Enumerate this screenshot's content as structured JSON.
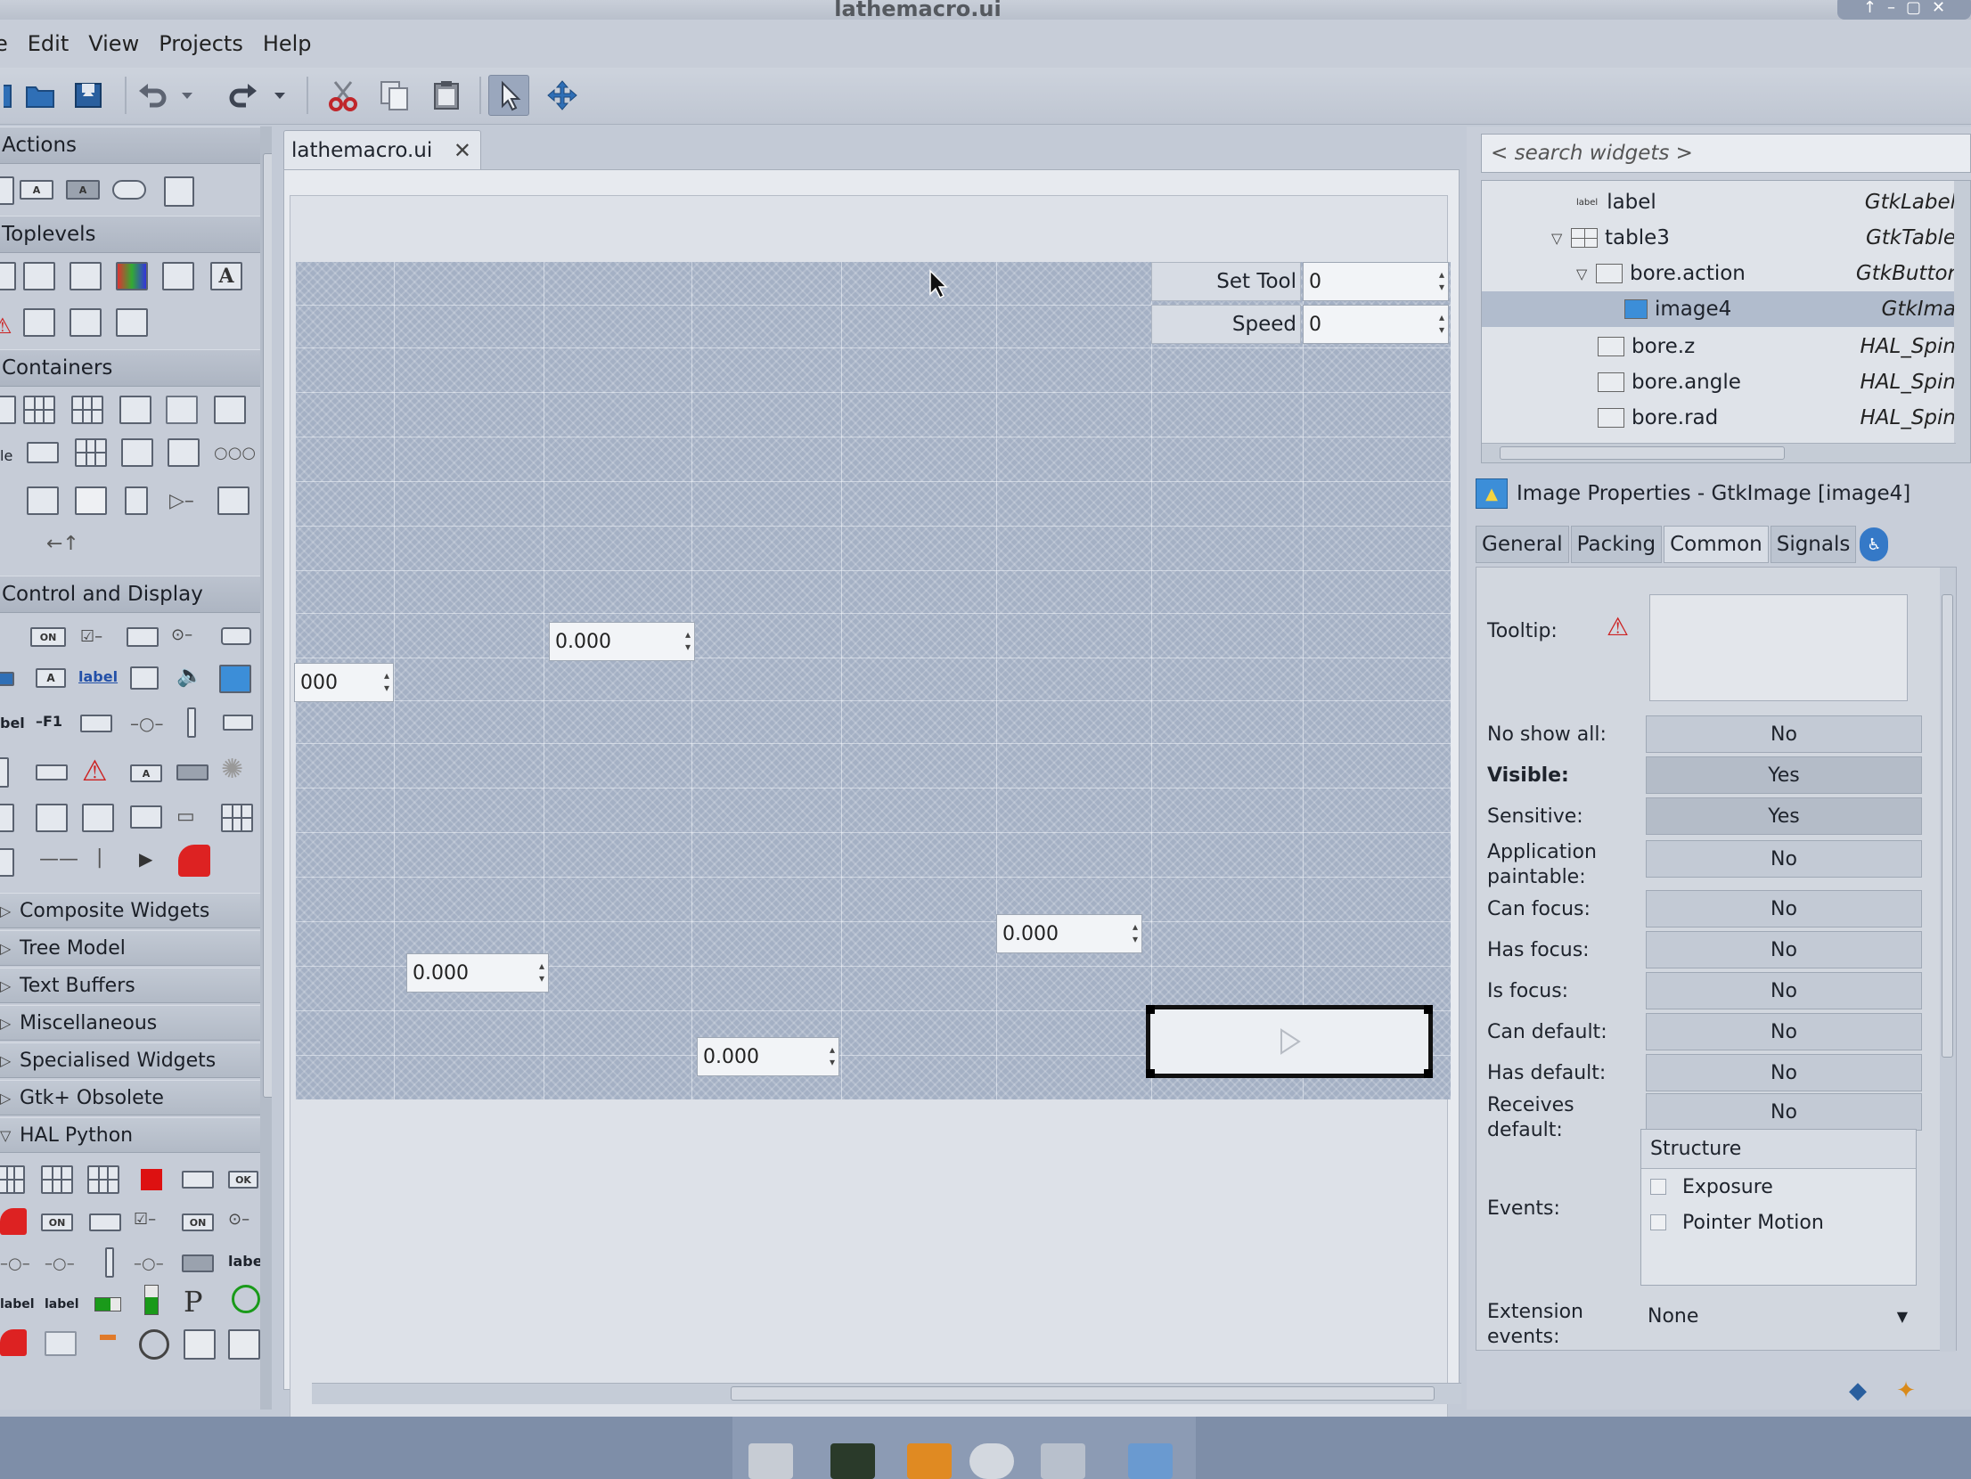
{
  "window": {
    "title": "lathemacro.ui"
  },
  "menu": [
    "e",
    "Edit",
    "View",
    "Projects",
    "Help"
  ],
  "toolbar": {
    "items": [
      "open-icon",
      "save-icon",
      "undo-icon",
      "undo-dropdown-icon",
      "redo-icon",
      "redo-dropdown-icon",
      "cut-icon",
      "copy-icon",
      "paste-icon",
      "select-pointer-icon",
      "drag-resize-icon"
    ]
  },
  "palette": {
    "groups": {
      "actions": "Actions",
      "toplevels": "Toplevels",
      "containers": "Containers",
      "control": "Control and Display",
      "composite": "Composite Widgets",
      "tree_model": "Tree Model",
      "text_buffers": "Text Buffers",
      "misc": "Miscellaneous",
      "specialised": "Specialised Widgets",
      "obsolete": "Gtk+ Obsolete",
      "hal_python": "HAL Python"
    },
    "icon_texts": {
      "on": "ON",
      "label": "label",
      "f1": "F1",
      "ok": "OK",
      "bel": "bel",
      "le": "le",
      "letter_a": "A"
    }
  },
  "document": {
    "tab_label": "lathemacro.ui",
    "set_tool_label": "Set Tool",
    "set_tool_value": "0",
    "speed_label": "Speed",
    "speed_value": "0",
    "spins": [
      "0.000",
      "000",
      "0.000",
      "0.000",
      "0.000"
    ]
  },
  "inspector": {
    "search_placeholder": "< search widgets >",
    "tree": [
      {
        "name": "label",
        "type": "GtkLabel"
      },
      {
        "name": "table3",
        "type": "GtkTable"
      },
      {
        "name": "bore.action",
        "type": "GtkButtor"
      },
      {
        "name": "image4",
        "type": "GtkIma"
      },
      {
        "name": "bore.z",
        "type": "HAL_Spin"
      },
      {
        "name": "bore.angle",
        "type": "HAL_Spin"
      },
      {
        "name": "bore.rad",
        "type": "HAL_Spin"
      }
    ],
    "tree_icon_text": "label"
  },
  "properties": {
    "title": "Image Properties - GtkImage [image4]",
    "tabs": [
      "General",
      "Packing",
      "Common",
      "Signals"
    ],
    "active_tab": "Common",
    "tooltip_label": "Tooltip:",
    "rows": [
      {
        "label": "No show all:",
        "value": "No"
      },
      {
        "label": "Visible:",
        "value": "Yes"
      },
      {
        "label": "Sensitive:",
        "value": "Yes"
      },
      {
        "label": "Application paintable:",
        "value": "No"
      },
      {
        "label": "Can focus:",
        "value": "No"
      },
      {
        "label": "Has focus:",
        "value": "No"
      },
      {
        "label": "Is focus:",
        "value": "No"
      },
      {
        "label": "Can default:",
        "value": "No"
      },
      {
        "label": "Has default:",
        "value": "No"
      },
      {
        "label": "Receives default:",
        "value": "No"
      }
    ],
    "events_label": "Events:",
    "events_header": "Structure",
    "events": [
      "Exposure",
      "Pointer Motion"
    ],
    "ext_events_label": "Extension events:",
    "ext_events_value": "None"
  }
}
